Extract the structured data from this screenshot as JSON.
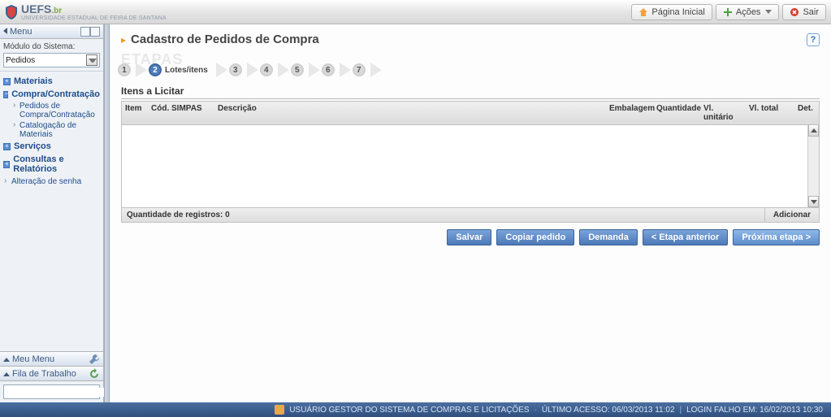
{
  "brand": {
    "name": "UEFS",
    "suffix": ".br",
    "subtitle": "UNIVERSIDADE ESTADUAL DE FEIRA DE SANTANA"
  },
  "header": {
    "home": "Página Inicial",
    "actions": "Ações",
    "logout": "Sair"
  },
  "sidebar": {
    "menu_label": "Menu",
    "module_label": "Módulo do Sistema:",
    "module_value": "Pedidos",
    "nav": {
      "materiais": "Materiais",
      "compra": "Compra/Contratação",
      "compra_sub": {
        "pedidos": "Pedidos de Compra/Contratação",
        "catalog": "Catalogação de Materiais"
      },
      "servicos": "Serviços",
      "consultas": "Consultas e Relatórios",
      "altsenha": "Alteração de senha"
    },
    "meu_menu": "Meu Menu",
    "fila": "Fila de Trabalho"
  },
  "page": {
    "title": "Cadastro de Pedidos de Compra",
    "steps_bg": "ETAPAS",
    "steps": {
      "s1": "1",
      "s2": "2",
      "s2_label": "Lotes/itens",
      "s3": "3",
      "s4": "4",
      "s5": "5",
      "s6": "6",
      "s7": "7"
    },
    "sub_title": "Itens a Licitar",
    "columns": {
      "item": "Item",
      "cod": "Cód. SIMPAS",
      "desc": "Descrição",
      "emb": "Embalagem",
      "qtd": "Quantidade",
      "vlu": "Vl. unitário",
      "vlt": "Vl. total",
      "det": "Det."
    },
    "registros_label": "Quantidade de registros:",
    "registros_valor": "0",
    "adicionar": "Adicionar",
    "buttons": {
      "salvar": "Salvar",
      "copiar": "Copiar pedido",
      "demanda": "Demanda",
      "anterior": "< Etapa anterior",
      "proxima": "Próxima etapa >"
    }
  },
  "footer": {
    "user": "USUÁRIO GESTOR DO SISTEMA DE COMPRAS E LICITAÇÕES",
    "ultimo": "ÚLTIMO ACESSO: 06/03/2013 11:02",
    "falho": "LOGIN FALHO EM: 16/02/2013 10:30"
  }
}
